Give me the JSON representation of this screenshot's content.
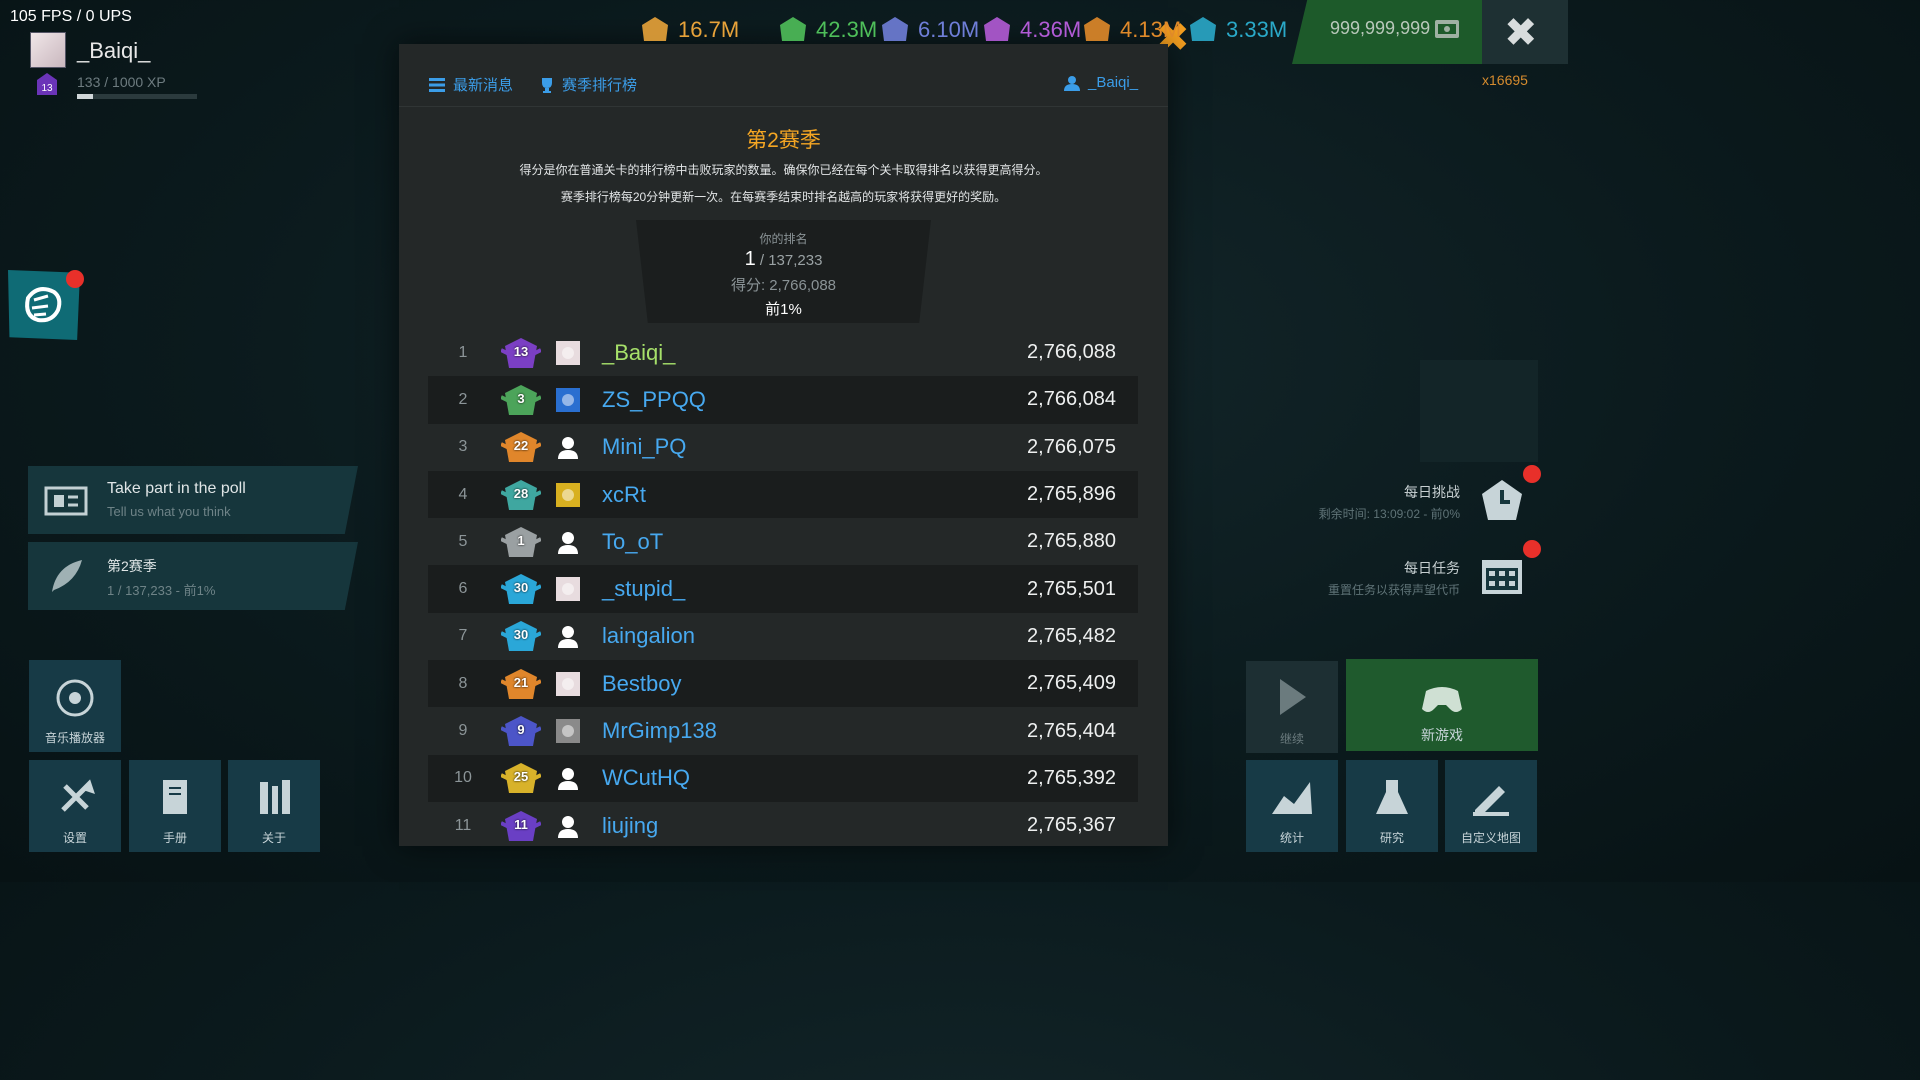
{
  "hud": {
    "fps": "105 FPS / 0 UPS",
    "player_name": "_Baiqi_",
    "level": "13",
    "xp_text": "133 / 1000 XP",
    "xp_fraction": 0.133
  },
  "resources": [
    {
      "icon": "scalar-icon",
      "value": "16.7M",
      "color": "#e8a33a"
    },
    {
      "icon": "vector-icon",
      "value": "42.3M",
      "color": "#4fbf5a"
    },
    {
      "icon": "matrix-icon",
      "value": "6.10M",
      "color": "#6f7ed8"
    },
    {
      "icon": "tensor-icon",
      "value": "4.36M",
      "color": "#b25bd6"
    },
    {
      "icon": "infiar-icon",
      "value": "4.13M",
      "color": "#e08a2a"
    },
    {
      "icon": "bits-icon",
      "value": "3.33M",
      "color": "#2aa9c8"
    }
  ],
  "money": "999,999,999",
  "tokens": "x16695",
  "modal": {
    "tabs": {
      "news": "最新消息",
      "leaderboard": "赛季排行榜",
      "profile": "_Baiqi_"
    },
    "season_title": "第2赛季",
    "desc1": "得分是你在普通关卡的排行榜中击败玩家的数量。确保你已经在每个关卡取得排名以获得更高得分。",
    "desc2": "赛季排行榜每20分钟更新一次。在每赛季结束时排名越高的玩家将获得更好的奖励。",
    "your_rank_label": "你的排名",
    "your_rank": "1",
    "your_rank_total": " / 137,233",
    "score_line": "得分: 2,766,088",
    "percent_line": "前1%",
    "rows": [
      {
        "rank": "1",
        "level": "13",
        "name": "_Baiqi_",
        "score": "2,766,088",
        "badge": "#7b3fc4",
        "avatar": "anime-avatar",
        "me": true
      },
      {
        "rank": "2",
        "level": "3",
        "name": "ZS_PPQQ",
        "score": "2,766,084",
        "badge": "#4ca45a",
        "avatar": "blue-flower-avatar"
      },
      {
        "rank": "3",
        "level": "22",
        "name": "Mini_PQ",
        "score": "2,766,075",
        "badge": "#e0862b",
        "avatar": "default-avatar"
      },
      {
        "rank": "4",
        "level": "28",
        "name": "xcRt",
        "score": "2,765,896",
        "badge": "#3fa7a0",
        "avatar": "sunflower-avatar"
      },
      {
        "rank": "5",
        "level": "1",
        "name": "To_oT",
        "score": "2,765,880",
        "badge": "#9aa0a2",
        "avatar": "default-avatar"
      },
      {
        "rank": "6",
        "level": "30",
        "name": "_stupid_",
        "score": "2,765,501",
        "badge": "#2aa7d8",
        "avatar": "anime-avatar"
      },
      {
        "rank": "7",
        "level": "30",
        "name": "laingalion",
        "score": "2,765,482",
        "badge": "#2aa7d8",
        "avatar": "default-avatar"
      },
      {
        "rank": "8",
        "level": "21",
        "name": "Bestboy",
        "score": "2,765,409",
        "badge": "#e0862b",
        "avatar": "anime-avatar"
      },
      {
        "rank": "9",
        "level": "9",
        "name": "MrGimp138",
        "score": "2,765,404",
        "badge": "#4c55c8",
        "avatar": "photo-avatar"
      },
      {
        "rank": "10",
        "level": "25",
        "name": "WCutHQ",
        "score": "2,765,392",
        "badge": "#d8b22a",
        "avatar": "default-avatar"
      },
      {
        "rank": "11",
        "level": "11",
        "name": "liujing",
        "score": "2,765,367",
        "badge": "#6a3fc4",
        "avatar": "default-avatar"
      }
    ]
  },
  "left": {
    "poll_title": "Take part in the poll",
    "poll_sub": "Tell us what you think",
    "season_title": "第2赛季",
    "season_sub": "1 / 137,233 - 前1%",
    "music": "音乐播放器",
    "settings": "设置",
    "handbook": "手册",
    "about": "关于"
  },
  "right": {
    "daily_challenge": "每日挑战",
    "daily_challenge_sub": "剩余时间: 13:09:02 - 前0%",
    "daily_quests": "每日任务",
    "daily_quests_sub": "重置任务以获得声望代币",
    "continue": "继续",
    "new_game": "新游戏",
    "stats": "统计",
    "research": "研究",
    "custom_map": "自定义地图"
  }
}
